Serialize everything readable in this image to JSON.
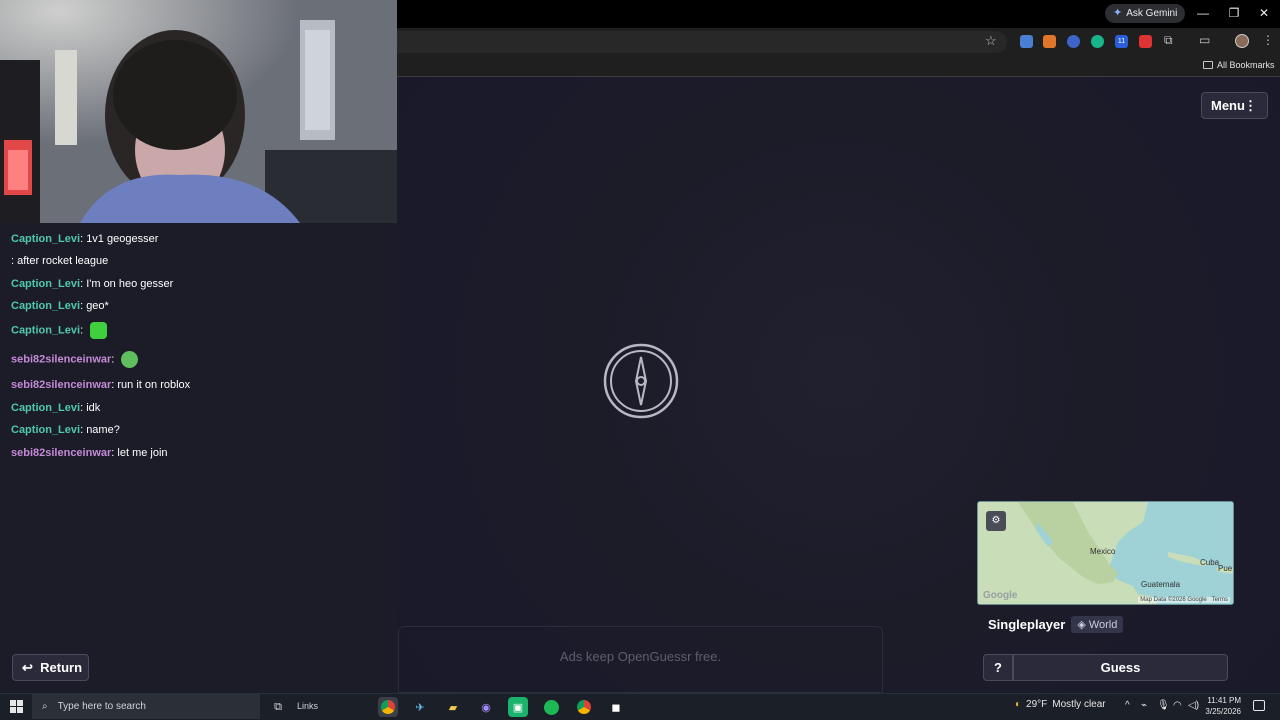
{
  "browser": {
    "ask_gemini": "Ask Gemini",
    "bookmarks_label": "All Bookmarks",
    "extension_badge": "11"
  },
  "game": {
    "menu_label": "Menu",
    "map_labels": [
      "Mexico",
      "Cuba",
      "Guatemala",
      "Pue"
    ],
    "map_attribution": "Map Data ©2026 Google",
    "map_terms": "Terms",
    "map_brand": "Google",
    "mode_title": "Singleplayer",
    "region_tag": "World",
    "help_label": "?",
    "guess_label": "Guess",
    "ads_text": "Ads keep OpenGuessr free.",
    "return_label": "Return"
  },
  "chat": [
    {
      "user": "Caption_Levi",
      "text": ": 1v1 geogesser"
    },
    {
      "user": "",
      "text": ": after rocket league"
    },
    {
      "user": "Caption_Levi",
      "text": ": I'm on heo gesser"
    },
    {
      "user": "Caption_Levi",
      "text": ": geo*"
    },
    {
      "user": "Caption_Levi",
      "text": ":"
    },
    {
      "user": "sebi82silenceinwar",
      "text": ":"
    },
    {
      "user": "sebi82silenceinwar",
      "text": ": run it on roblox"
    },
    {
      "user": "Caption_Levi",
      "text": ": idk"
    },
    {
      "user": "Caption_Levi",
      "text": ": name?"
    },
    {
      "user": "sebi82silenceinwar",
      "text": ": let me join"
    }
  ],
  "taskbar": {
    "search_placeholder": "Type here to search",
    "links_label": "Links",
    "temperature": "29°F",
    "weather": "Mostly clear",
    "time": "11:41 PM",
    "date": "3/25/2026"
  },
  "colors": {
    "page_bg": "#1c1c29",
    "levi": "#4fc9a8",
    "sebi": "#c48ad6"
  }
}
